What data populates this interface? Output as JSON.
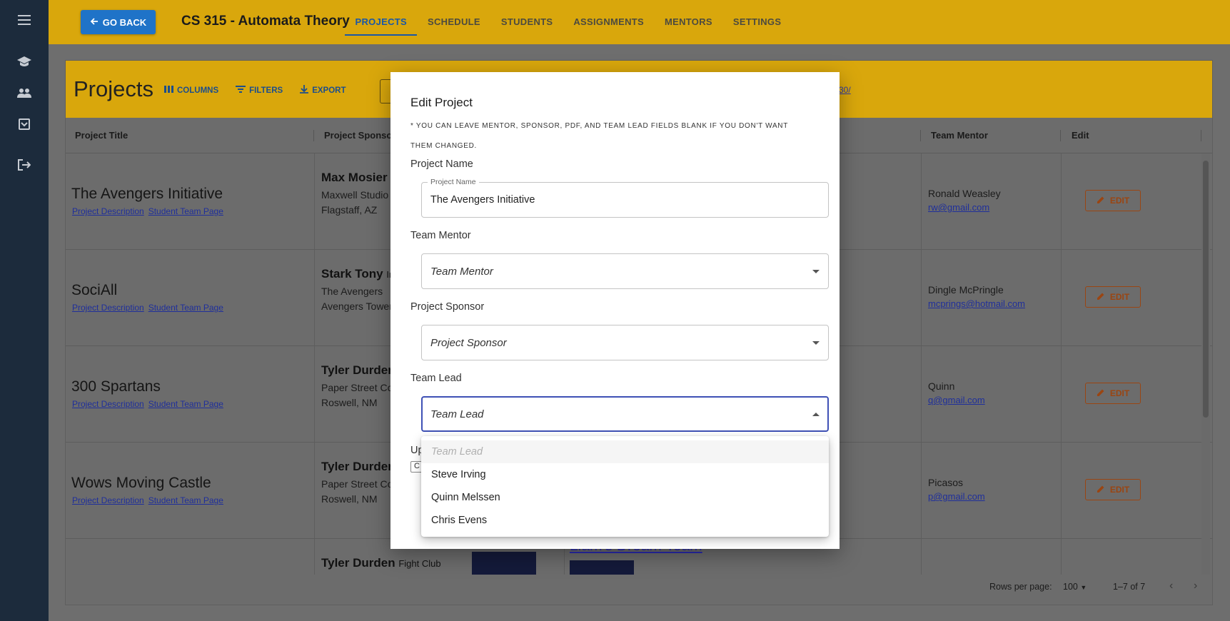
{
  "rail": {
    "icons": [
      "menu-icon",
      "school-icon",
      "people-icon",
      "inbox-icon",
      "logout-icon"
    ]
  },
  "topbar": {
    "back_label": "GO BACK",
    "course_title": "CS 315 - Automata Theory",
    "tabs": [
      {
        "label": "PROJECTS",
        "active": true
      },
      {
        "label": "SCHEDULE",
        "active": false
      },
      {
        "label": "STUDENTS",
        "active": false
      },
      {
        "label": "ASSIGNMENTS",
        "active": false
      },
      {
        "label": "MENTORS",
        "active": false
      },
      {
        "label": "SETTINGS",
        "active": false
      }
    ],
    "accent_color": "#d9a70c",
    "active_color": "#1957a7"
  },
  "page": {
    "title": "Projects",
    "toolbar": {
      "columns": "COLUMNS",
      "filters": "FILTERS",
      "export": "EXPORT"
    },
    "header_link": "30/",
    "columns": [
      "Project Title",
      "Project Sponsor",
      "Team Mentor",
      "Edit"
    ],
    "rows": [
      {
        "title": "The Avengers Initiative",
        "desc_link": "Project Description",
        "team_link": "Student Team Page",
        "sponsor": "Max Mosier",
        "sponsor_suffix": "",
        "sponsor_line1": "Maxwell Studio",
        "sponsor_line2": "Flagstaff, AZ",
        "mentor": "Ronald Weasley",
        "mentor_email": "rw@gmail.com",
        "edit": "EDIT"
      },
      {
        "title": "SociAll",
        "desc_link": "Project Description",
        "team_link": "Student Team Page",
        "sponsor": "Stark Tony",
        "sponsor_suffix": "In",
        "sponsor_line1": "The Avengers",
        "sponsor_line2": "Avengers Tower",
        "mentor": "Dingle McPringle",
        "mentor_email": "mcprings@hotmail.com",
        "edit": "EDIT"
      },
      {
        "title": "300 Spartans",
        "desc_link": "Project Description",
        "team_link": "Student Team Page",
        "sponsor": "Tyler Durden",
        "sponsor_suffix": "",
        "sponsor_line1": "Paper Street Co",
        "sponsor_line2": "Roswell, NM",
        "mentor": "Quinn",
        "mentor_email": "q@gmail.com",
        "edit": "EDIT"
      },
      {
        "title": "Wows Moving Castle",
        "desc_link": "Project Description",
        "team_link": "Student Team Page",
        "sponsor": "Tyler Durden",
        "sponsor_suffix": "",
        "sponsor_line1": "Paper Street Co",
        "sponsor_line2": "Roswell, NM",
        "mentor": "Picasos",
        "mentor_email": "p@gmail.com",
        "edit": "EDIT"
      }
    ],
    "partial_row": {
      "sponsor": "Tyler Durden",
      "sponsor_suffix": "Fight Club",
      "team_link": "Liam's Dream Team"
    },
    "footer": {
      "rows_per_page_label": "Rows per page:",
      "rows_per_page": "100",
      "range": "1–7 of 7"
    }
  },
  "modal": {
    "title": "Edit Project",
    "note": "* YOU CAN LEAVE MENTOR, SPONSOR, PDF, AND TEAM LEAD FIELDS BLANK IF YOU DON'T WANT THEM CHANGED.",
    "project_name": {
      "label": "Project Name",
      "legend": "Project Name",
      "value": "The Avengers Initiative"
    },
    "team_mentor": {
      "label": "Team Mentor",
      "placeholder": "Team Mentor"
    },
    "project_sponsor": {
      "label": "Project Sponsor",
      "placeholder": "Project Sponsor"
    },
    "team_lead": {
      "label": "Team Lead",
      "placeholder": "Team Lead"
    },
    "hidden_label_fragment": "Up",
    "hidden_button_fragment": "C",
    "focus_color": "#3f51b5"
  },
  "dropdown": {
    "placeholder": "Team Lead",
    "options": [
      "Steve Irving",
      "Quinn Melssen",
      "Chris Evens"
    ]
  }
}
